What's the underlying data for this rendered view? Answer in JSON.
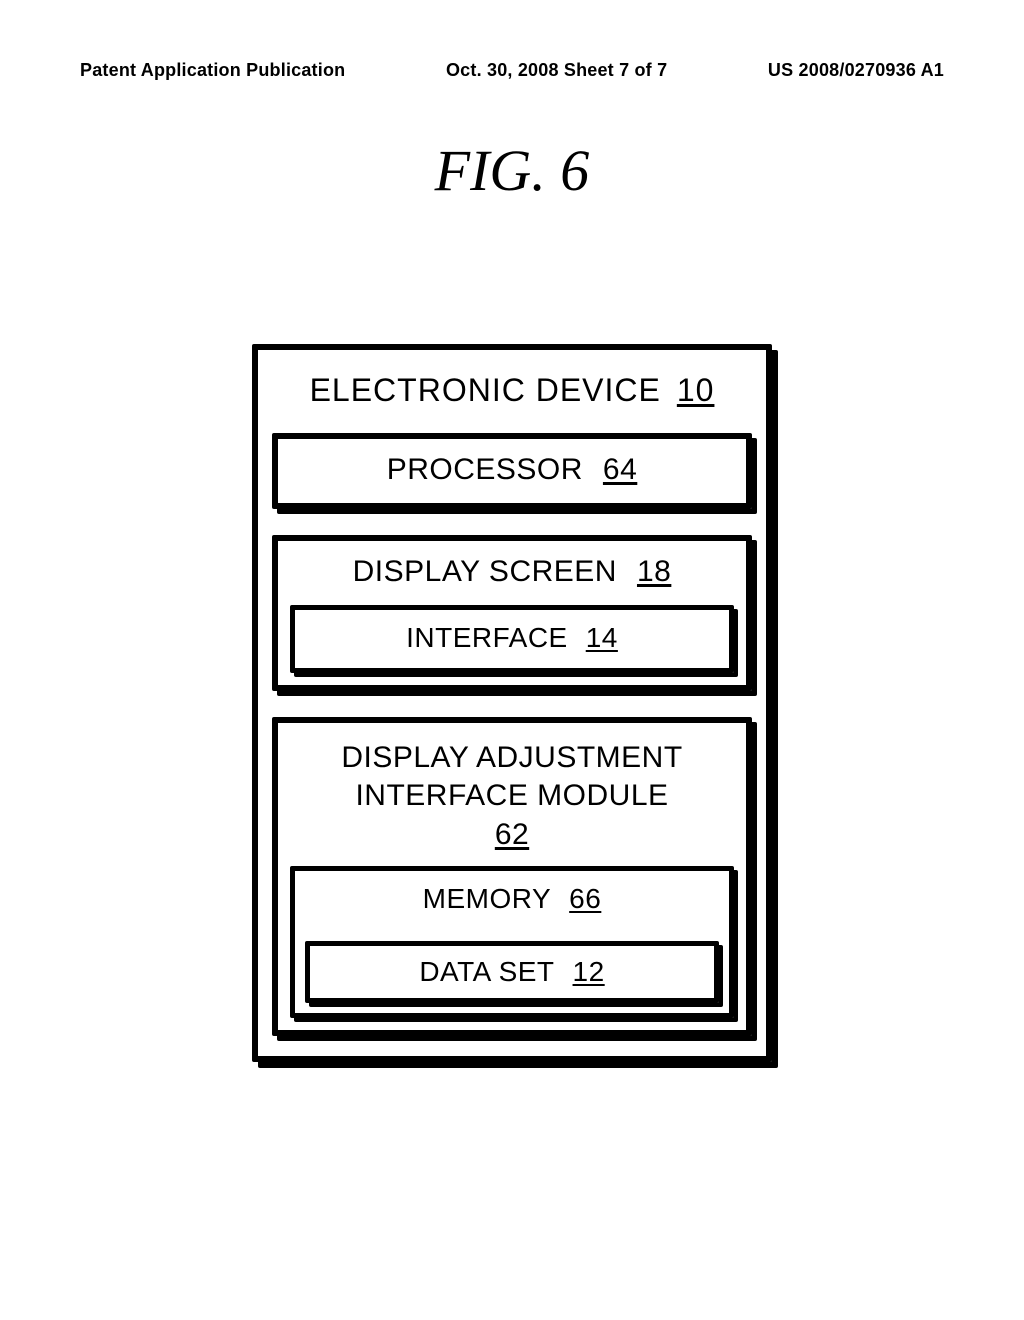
{
  "header": {
    "left": "Patent Application Publication",
    "center": "Oct. 30, 2008   Sheet 7 of 7",
    "right": "US 2008/0270936 A1"
  },
  "figure_title": "FIG. 6",
  "device": {
    "label": "ELECTRONIC DEVICE",
    "ref": "10",
    "processor": {
      "label": "PROCESSOR",
      "ref": "64"
    },
    "display_screen": {
      "label": "DISPLAY SCREEN",
      "ref": "18",
      "interface": {
        "label": "INTERFACE",
        "ref": "14"
      }
    },
    "adjustment_module": {
      "label": "DISPLAY ADJUSTMENT\nINTERFACE MODULE",
      "ref": "62",
      "memory": {
        "label": "MEMORY",
        "ref": "66",
        "dataset": {
          "label": "DATA SET",
          "ref": "12"
        }
      }
    }
  }
}
